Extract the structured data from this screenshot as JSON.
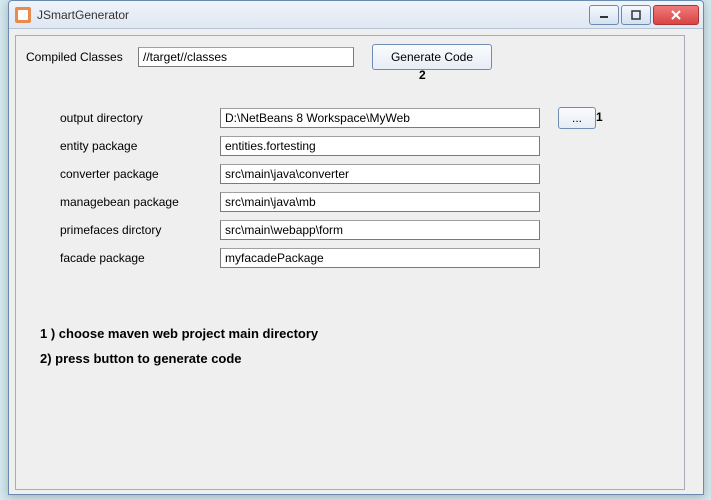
{
  "window": {
    "title": "JSmartGenerator"
  },
  "toolbar": {
    "compiled_label": "Compiled Classes",
    "compiled_value": "//target//classes",
    "generate_label": "Generate Code"
  },
  "annotations": {
    "one": "1",
    "two": "2"
  },
  "form": {
    "output_dir_label": "output directory",
    "output_dir_value": "D:\\NetBeans 8 Workspace\\MyWeb",
    "entity_pkg_label": "entity package",
    "entity_pkg_value": "entities.fortesting",
    "converter_pkg_label": "converter  package",
    "converter_pkg_value": "src\\main\\java\\converter",
    "managebean_pkg_label": "managebean package",
    "managebean_pkg_value": "src\\main\\java\\mb",
    "primefaces_dir_label": "primefaces dirctory",
    "primefaces_dir_value": "src\\main\\webapp\\form",
    "facade_pkg_label": "facade package",
    "facade_pkg_value": "myfacadePackage",
    "browse_label": "..."
  },
  "notes": {
    "line1": "1 ) choose maven web project main directory",
    "line2": "2) press button to generate code"
  }
}
